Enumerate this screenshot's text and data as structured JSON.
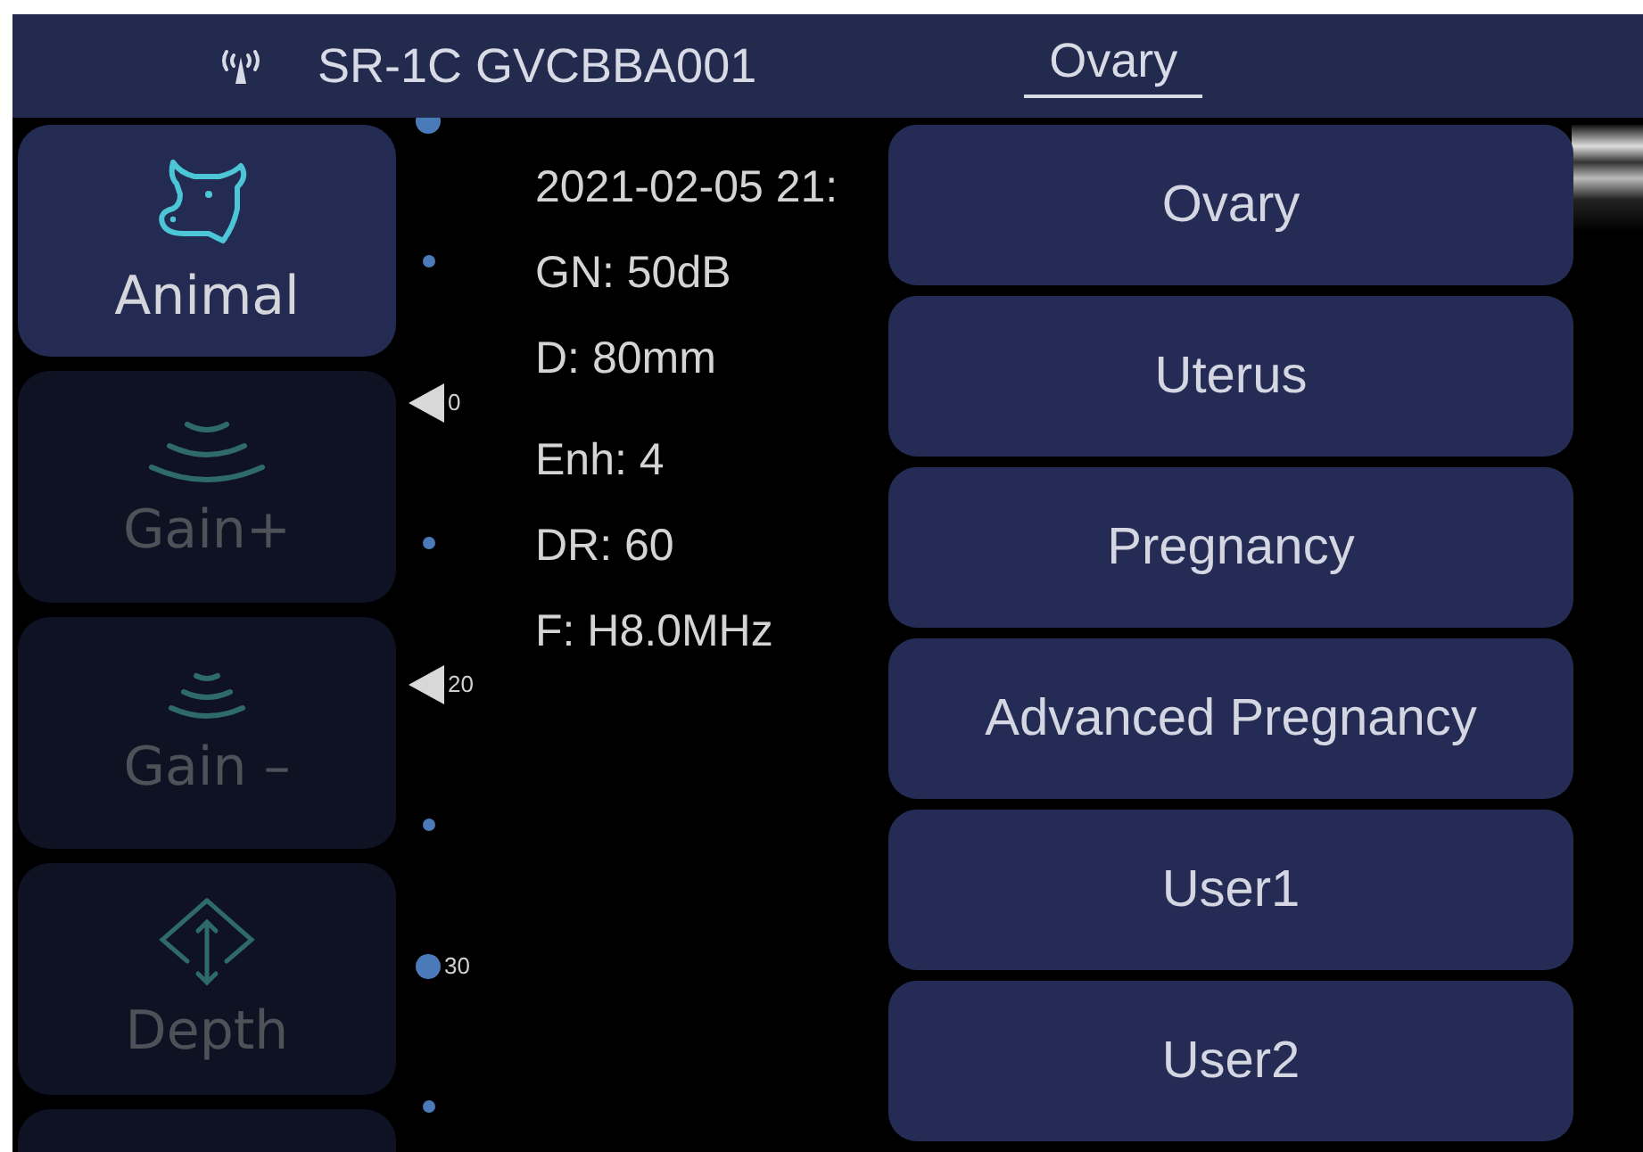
{
  "header": {
    "device": "SR-1C GVCBBA001",
    "preset": "Ovary"
  },
  "side_buttons": [
    {
      "kind": "animal",
      "label": "Animal",
      "disabled": false
    },
    {
      "kind": "gain-up",
      "label": "Gain+",
      "disabled": true
    },
    {
      "kind": "gain-down",
      "label": "Gain –",
      "disabled": true
    },
    {
      "kind": "depth",
      "label": "Depth",
      "disabled": true
    },
    {
      "kind": "partial",
      "disabled": true
    }
  ],
  "scale": [
    {
      "kind": "big-dot"
    },
    {
      "kind": "dot"
    },
    {
      "kind": "marker",
      "label": "0"
    },
    {
      "kind": "dot"
    },
    {
      "kind": "marker",
      "label": "20"
    },
    {
      "kind": "dot"
    },
    {
      "kind": "big-dot",
      "label": "30"
    },
    {
      "kind": "dot"
    }
  ],
  "info": [
    "2021-02-05 21:",
    "GN: 50dB",
    "D: 80mm",
    "Enh: 4",
    "DR: 60",
    "F: H8.0MHz"
  ],
  "preset_menu": [
    "Ovary",
    "Uterus",
    "Pregnancy",
    "Advanced Pregnancy",
    "User1",
    "User2"
  ]
}
